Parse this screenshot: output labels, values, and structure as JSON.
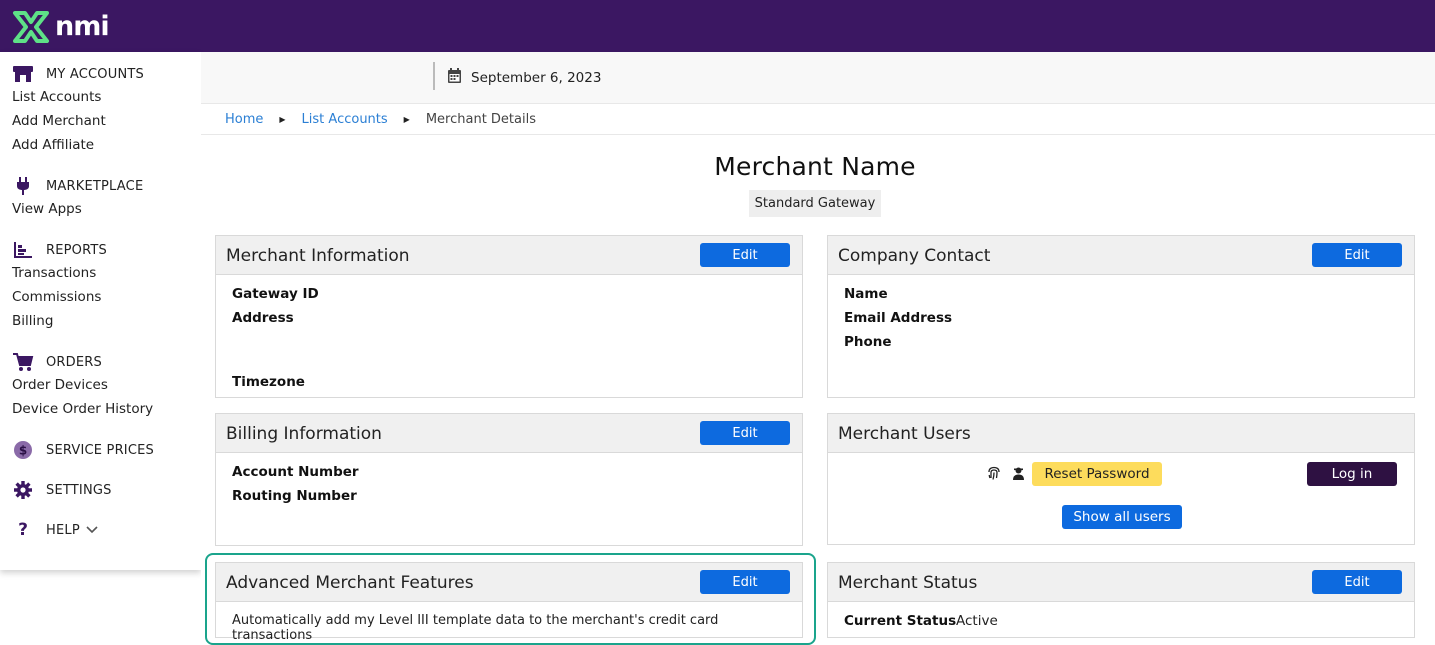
{
  "brand": {
    "logo_text": "nmi",
    "topbar_color": "#3b1762",
    "accent_color": "#5ee187"
  },
  "sidebar": {
    "sections": [
      {
        "label": "MY ACCOUNTS",
        "icon": "storefront-icon",
        "links": [
          "List Accounts",
          "Add Merchant",
          "Add Affiliate"
        ]
      },
      {
        "label": "MARKETPLACE",
        "icon": "plug-icon",
        "links": [
          "View Apps"
        ]
      },
      {
        "label": "REPORTS",
        "icon": "bar-chart-icon",
        "links": [
          "Transactions",
          "Commissions",
          "Billing"
        ]
      },
      {
        "label": "ORDERS",
        "icon": "cart-icon",
        "links": [
          "Order Devices",
          "Device Order History"
        ]
      },
      {
        "label": "SERVICE PRICES",
        "icon": "dollar-coin-icon",
        "links": []
      },
      {
        "label": "SETTINGS",
        "icon": "gear-icon",
        "links": []
      },
      {
        "label": "HELP",
        "icon": "question-icon",
        "links": []
      }
    ]
  },
  "header": {
    "date": "September 6, 2023"
  },
  "breadcrumb": {
    "items": [
      "Home",
      "List Accounts",
      "Merchant Details"
    ]
  },
  "merchant": {
    "name": "Merchant Name",
    "gateway_type": "Standard Gateway"
  },
  "panels": {
    "merchant_info": {
      "title": "Merchant Information",
      "edit": "Edit",
      "fields": [
        "Gateway ID",
        "Address",
        "Timezone"
      ]
    },
    "company_contact": {
      "title": "Company Contact",
      "edit": "Edit",
      "fields": [
        "Name",
        "Email Address",
        "Phone"
      ]
    },
    "billing_info": {
      "title": "Billing Information",
      "edit": "Edit",
      "fields": [
        "Account Number",
        "Routing Number"
      ]
    },
    "merchant_users": {
      "title": "Merchant Users",
      "reset": "Reset Password",
      "login": "Log in",
      "show_all": "Show all users"
    },
    "advanced": {
      "title": "Advanced Merchant Features",
      "edit": "Edit",
      "text": "Automatically add my Level III template data to the merchant's credit card transactions"
    },
    "status": {
      "title": "Merchant Status",
      "edit": "Edit",
      "label": "Current Status",
      "value": "Active"
    }
  },
  "colors": {
    "primary_button": "#0d6adf",
    "reset_button": "#fddc5c",
    "login_button": "#2e1142",
    "highlight": "#1aa48c"
  }
}
